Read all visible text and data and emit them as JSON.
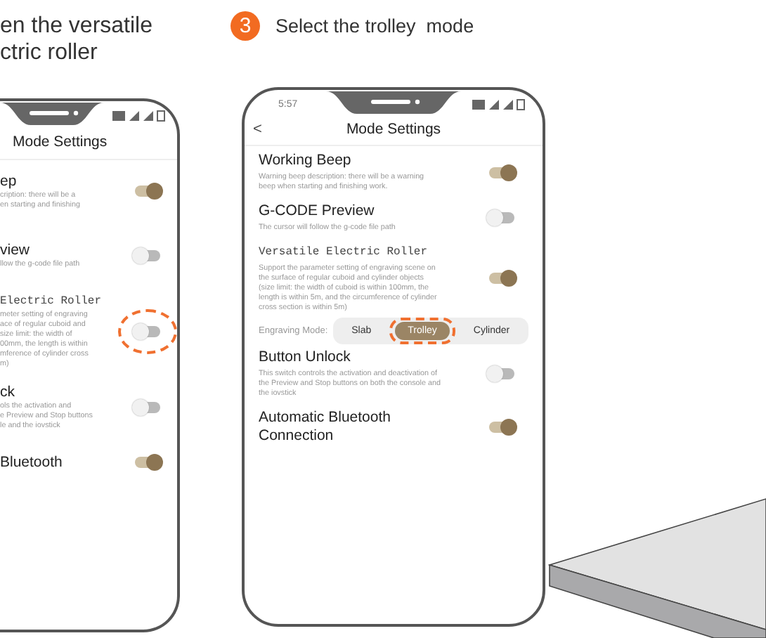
{
  "left_panel": {
    "heading_lines": [
      "en the versatile",
      "ctric roller"
    ],
    "phone": {
      "title": "Mode Settings",
      "settings": [
        {
          "kind": "toggle",
          "title": "ep",
          "description_lines": [
            "cription: there will be a",
            "en starting and finishing"
          ],
          "on": true,
          "highlighted": false
        },
        {
          "kind": "toggle",
          "title": "view",
          "description_lines": [
            "llow the g-code file path"
          ],
          "on": false,
          "highlighted": false
        },
        {
          "kind": "feature_toggle",
          "title": "Electric Roller",
          "description_lines": [
            "meter setting of engraving",
            "ace of regular cuboid and",
            "size limit: the width of",
            "00mm, the length is within",
            "mference of cylinder cross",
            "m)"
          ],
          "on": false,
          "highlighted": true
        },
        {
          "kind": "toggle",
          "title": "ck",
          "description_lines": [
            "ols the activation and",
            "e Preview and Stop buttons",
            "le and the iovstick"
          ],
          "on": false,
          "highlighted": false
        },
        {
          "kind": "toggle",
          "title": "Bluetooth",
          "on": true,
          "highlighted": false
        }
      ]
    }
  },
  "right_panel": {
    "step_number": "3",
    "heading": "Select the trolley  mode",
    "phone": {
      "time": "5:57",
      "back": "<",
      "title": "Mode Settings",
      "settings": [
        {
          "kind": "toggle",
          "title": "Working Beep",
          "description": "Warning beep description: there will be a warning beep when starting and finishing work.",
          "on": true,
          "highlighted": false
        },
        {
          "kind": "toggle",
          "title": "G-CODE Preview",
          "description": "The cursor will follow the g-code file path",
          "on": false,
          "highlighted": false
        },
        {
          "kind": "feature_toggle",
          "title": "Versatile Electric Roller",
          "description": "Support the parameter setting of engraving scene on the surface of regular cuboid and cylinder objects (size limit: the width of cuboid is within 100mm, the length is within 5m, and the circumference of cylinder cross section is within 5m)",
          "on": true,
          "highlighted": false
        },
        {
          "kind": "mode_selector",
          "label": "Engraving Mode:",
          "options": [
            {
              "label": "Slab",
              "selected": false,
              "highlighted": false
            },
            {
              "label": "Trolley",
              "selected": true,
              "highlighted": true
            },
            {
              "label": "Cylinder",
              "selected": false,
              "highlighted": false
            }
          ]
        },
        {
          "kind": "toggle",
          "title": "Button Unlock",
          "description": "This switch controls the activation and deactivation of the Preview and Stop buttons on both the console and the iovstick",
          "on": false,
          "highlighted": false
        },
        {
          "kind": "toggle",
          "title": "Automatic Bluetooth Connection",
          "on": true,
          "highlighted": false
        }
      ]
    }
  }
}
